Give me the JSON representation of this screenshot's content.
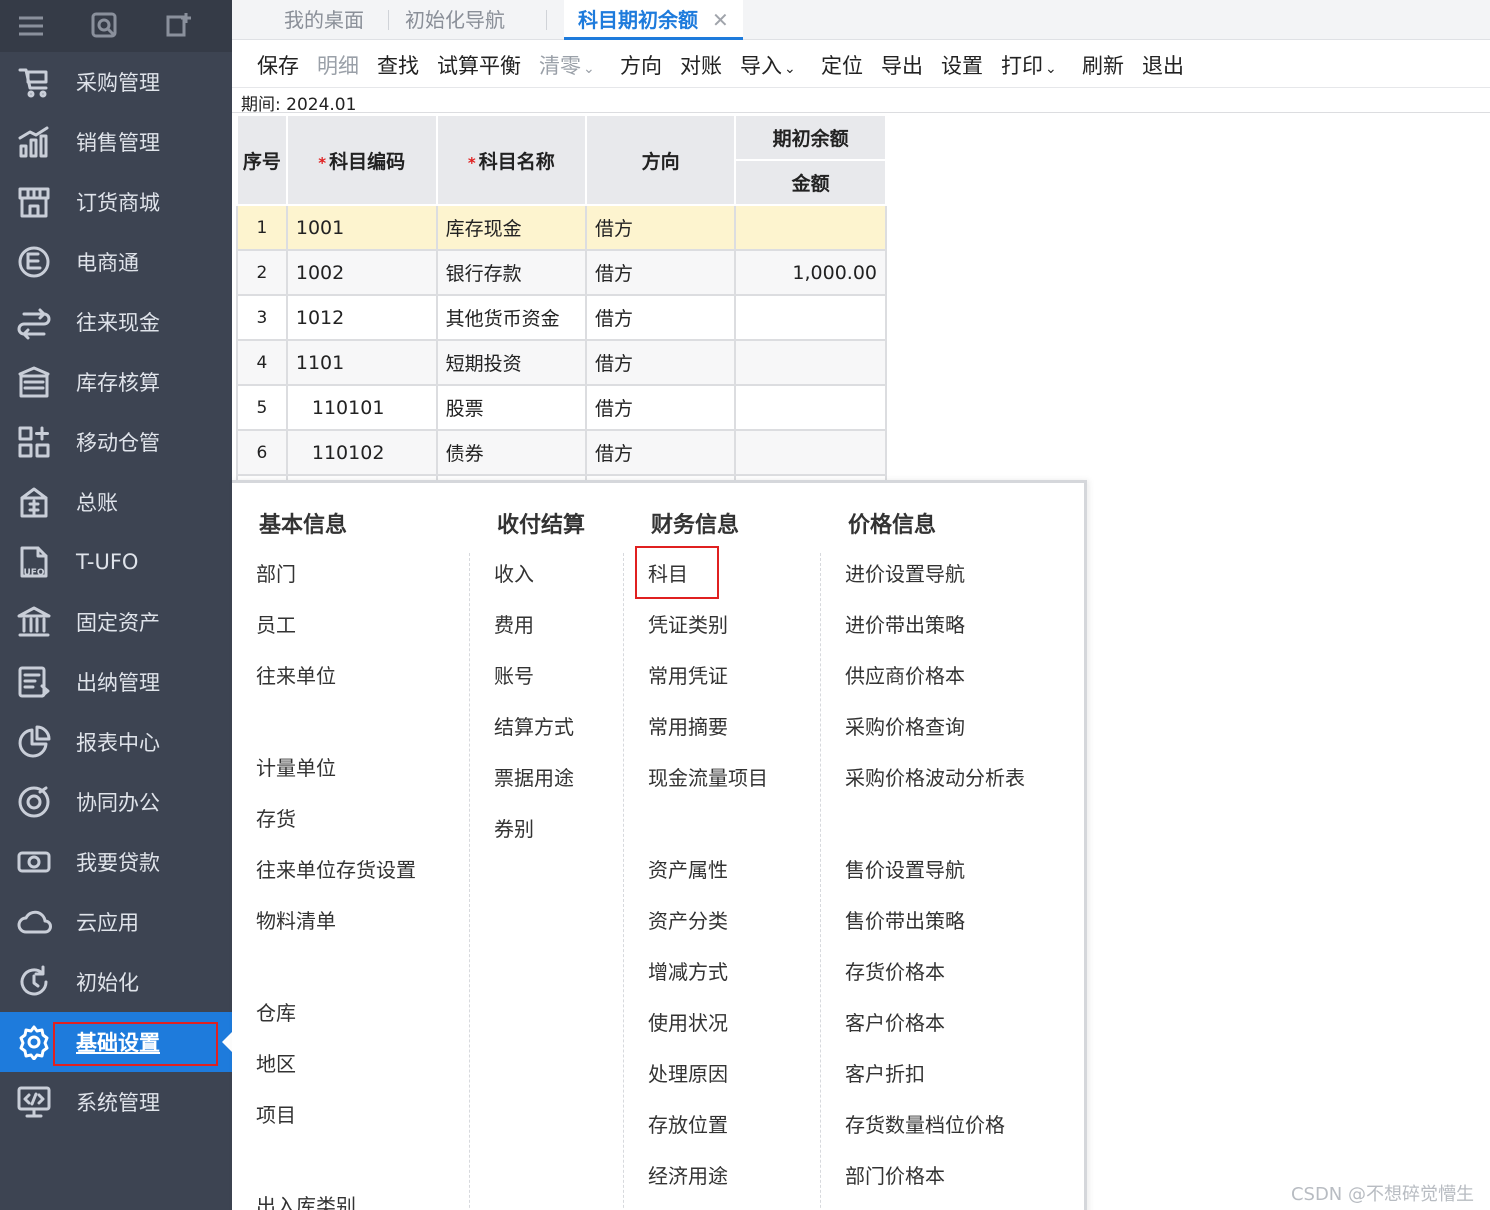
{
  "sidebar": {
    "items": [
      {
        "label": "采购管理",
        "icon": "cart-icon"
      },
      {
        "label": "销售管理",
        "icon": "chart-bars-icon"
      },
      {
        "label": "订货商城",
        "icon": "store-icon"
      },
      {
        "label": "电商通",
        "icon": "ecommerce-icon"
      },
      {
        "label": "往来现金",
        "icon": "cash-flow-icon"
      },
      {
        "label": "库存核算",
        "icon": "warehouse-icon"
      },
      {
        "label": "移动仓管",
        "icon": "grid-add-icon"
      },
      {
        "label": "总账",
        "icon": "ledger-icon"
      },
      {
        "label": "T-UFO",
        "icon": "ufo-file-icon"
      },
      {
        "label": "固定资产",
        "icon": "bank-icon"
      },
      {
        "label": "出纳管理",
        "icon": "cashier-icon"
      },
      {
        "label": "报表中心",
        "icon": "pie-chart-icon"
      },
      {
        "label": "协同办公",
        "icon": "collab-icon"
      },
      {
        "label": "我要贷款",
        "icon": "money-icon"
      },
      {
        "label": "云应用",
        "icon": "cloud-icon"
      },
      {
        "label": "初始化",
        "icon": "refresh-icon"
      },
      {
        "label": "基础设置",
        "icon": "settings-gear-icon"
      },
      {
        "label": "系统管理",
        "icon": "monitor-code-icon"
      }
    ],
    "active_index": 16
  },
  "tabs": {
    "items": [
      "我的桌面",
      "初始化导航",
      "科目期初余额"
    ],
    "close_glyph": "✕"
  },
  "toolbar": {
    "save": "保存",
    "detail": "明细",
    "find": "查找",
    "trial_balance": "试算平衡",
    "clear": "清零",
    "direction": "方向",
    "reconcile": "对账",
    "import": "导入",
    "locate": "定位",
    "export": "导出",
    "settings": "设置",
    "print": "打印",
    "refresh": "刷新",
    "exit": "退出",
    "caret": "⌄"
  },
  "period": "期间: 2024.01",
  "grid": {
    "headers": {
      "seq": "序号",
      "code": "科目编码",
      "name": "科目名称",
      "direction": "方向",
      "opening": "期初余额",
      "amount": "金额",
      "required_mark": "*"
    },
    "rows": [
      {
        "seq": "1",
        "code": "1001",
        "name": "库存现金",
        "direction": "借方",
        "amount": ""
      },
      {
        "seq": "2",
        "code": "1002",
        "name": "银行存款",
        "direction": "借方",
        "amount": "1,000.00"
      },
      {
        "seq": "3",
        "code": "1012",
        "name": "其他货币资金",
        "direction": "借方",
        "amount": ""
      },
      {
        "seq": "4",
        "code": "1101",
        "name": "短期投资",
        "direction": "借方",
        "amount": ""
      },
      {
        "seq": "5",
        "code": "110101",
        "name": "股票",
        "direction": "借方",
        "amount": ""
      },
      {
        "seq": "6",
        "code": "110102",
        "name": "债券",
        "direction": "借方",
        "amount": ""
      }
    ]
  },
  "menu": {
    "basic": {
      "title": "基本信息",
      "items": [
        "部门",
        "员工",
        "往来单位",
        "计量单位",
        "存货",
        "往来单位存货设置",
        "物料清单",
        "仓库",
        "地区",
        "项目",
        "出入库类别"
      ]
    },
    "payment": {
      "title": "收付结算",
      "items": [
        "收入",
        "费用",
        "账号",
        "结算方式",
        "票据用途",
        "券别"
      ]
    },
    "finance": {
      "title": "财务信息",
      "items": [
        "科目",
        "凭证类别",
        "常用凭证",
        "常用摘要",
        "现金流量项目",
        "资产属性",
        "资产分类",
        "增减方式",
        "使用状况",
        "处理原因",
        "存放位置",
        "经济用途"
      ]
    },
    "price": {
      "title": "价格信息",
      "items": [
        "进价设置导航",
        "进价带出策略",
        "供应商价格本",
        "采购价格查询",
        "采购价格波动分析表",
        "售价设置导航",
        "售价带出策略",
        "存货价格本",
        "客户价格本",
        "客户折扣",
        "存货数量档位价格",
        "部门价格本"
      ]
    }
  },
  "watermark": "CSDN @不想碎觉懵生",
  "colors": {
    "sidebar_bg": "#3d4452",
    "active_blue": "#1e7bdc",
    "highlight_red": "#e02020",
    "selected_row": "#fdf4cf"
  }
}
